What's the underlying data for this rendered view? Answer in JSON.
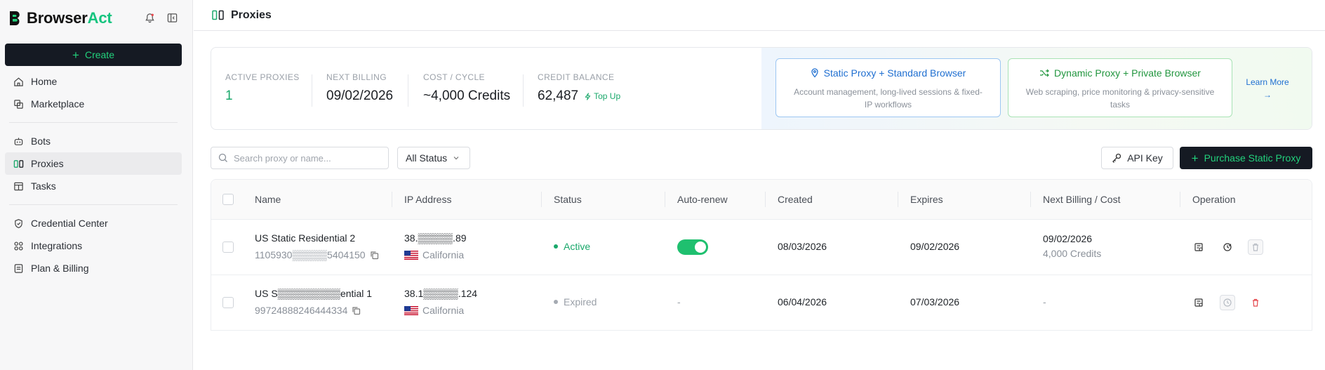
{
  "brand": {
    "name_prefix": "Browser",
    "name_accent": "Act"
  },
  "sidebar": {
    "create_label": "Create",
    "group1": [
      {
        "label": "Home"
      },
      {
        "label": "Marketplace"
      }
    ],
    "group2": [
      {
        "label": "Bots"
      },
      {
        "label": "Proxies"
      },
      {
        "label": "Tasks"
      }
    ],
    "group3": [
      {
        "label": "Credential Center"
      },
      {
        "label": "Integrations"
      },
      {
        "label": "Plan & Billing"
      }
    ]
  },
  "header": {
    "title": "Proxies"
  },
  "stats": {
    "active": {
      "label": "ACTIVE PROXIES",
      "value": "1"
    },
    "billing": {
      "label": "NEXT BILLING",
      "value": "09/02/2026"
    },
    "cost": {
      "label": "COST / CYCLE",
      "value": "~4,000 Credits"
    },
    "credit": {
      "label": "CREDIT BALANCE",
      "value": "62,487",
      "topup": "Top Up"
    }
  },
  "promos": {
    "static": {
      "title": "Static Proxy + Standard Browser",
      "desc": "Account management, long-lived sessions & fixed-IP workflows"
    },
    "dynamic": {
      "title": "Dynamic Proxy + Private Browser",
      "desc": "Web scraping, price monitoring & privacy-sensitive tasks"
    },
    "learn_more": "Learn More",
    "learn_arrow": "→"
  },
  "toolbar": {
    "search_placeholder": "Search proxy or name...",
    "status_filter": "All Status",
    "api_key": "API Key",
    "purchase": "Purchase Static Proxy"
  },
  "table": {
    "columns": [
      "Name",
      "IP Address",
      "Status",
      "Auto-renew",
      "Created",
      "Expires",
      "Next Billing / Cost",
      "Operation"
    ],
    "rows": [
      {
        "name": "US Static Residential 2",
        "id": "1105930▒▒▒▒▒5404150",
        "ip": "38.▒▒▒▒▒.89",
        "location": "California",
        "status": "Active",
        "auto_renew": true,
        "created": "08/03/2026",
        "expires": "09/02/2026",
        "next_billing": "09/02/2026",
        "cost": "4,000 Credits"
      },
      {
        "name": "US S▒▒▒▒▒▒▒▒▒ential 1",
        "id": "99724888246444334",
        "ip": "38.1▒▒▒▒▒.124",
        "location": "California",
        "status": "Expired",
        "auto_renew_text": "-",
        "created": "06/04/2026",
        "expires": "07/03/2026",
        "next_billing_text": "-"
      }
    ]
  },
  "colors": {
    "accent_green": "#22d17c",
    "dark_button": "#151a23",
    "active_status": "#1aa86b",
    "toggle_on": "#1fc06f",
    "link_blue": "#1f6fd1"
  }
}
